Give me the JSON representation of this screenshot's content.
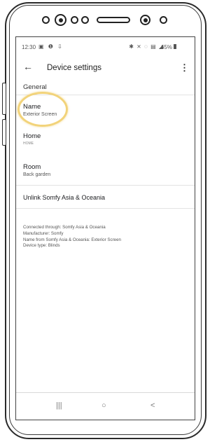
{
  "status_bar": {
    "time": "12:30",
    "left_icons": "▣ ❶ ⇩",
    "right_icons": "✱ ⨯ ◌ ▤ ◢",
    "battery": "65%"
  },
  "app_bar": {
    "back_icon": "←",
    "title": "Device settings",
    "more_icon": "⋮"
  },
  "section": {
    "header": "General"
  },
  "settings": [
    {
      "label": "Name",
      "value": "Exterior Screen"
    },
    {
      "label": "Home",
      "value": "HOME"
    },
    {
      "label": "Room",
      "value": "Back garden"
    }
  ],
  "unlink_label": "Unlink Somfy Asia & Oceania",
  "info_lines": [
    "Connected through: Somfy Asia & Oceania",
    "Manufacturer: Somfy",
    "Name from Somfy Asia & Oceania: Exterior Screen",
    "Device type: Blinds"
  ],
  "nav": {
    "recents": "|||",
    "home": "○",
    "back": "<"
  },
  "colors": {
    "highlight": "#f2d37a",
    "text": "#202124",
    "secondary": "#555555"
  }
}
